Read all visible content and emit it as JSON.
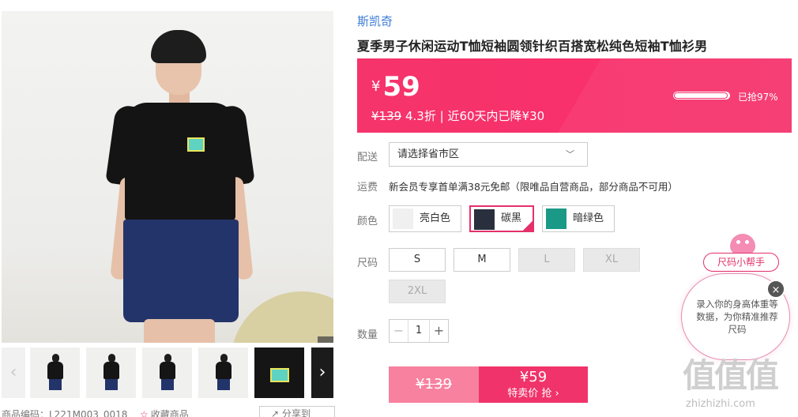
{
  "gallery": {
    "zoom_icon": "magnifier-icon",
    "prev_icon": "chevron-left-icon",
    "next_icon": "chevron-right-icon"
  },
  "meta": {
    "code": "商品编码：L221M003_0018",
    "favorite": "收藏商品",
    "share": "分享到"
  },
  "product": {
    "brand": "斯凯奇",
    "title": "夏季男子休闲运动T恤短袖圆领针织百搭宽松纯色短袖T恤衫男"
  },
  "price": {
    "currency": "¥",
    "current": "59",
    "original": "¥139",
    "discount": "4.3折",
    "drop_note": "近60天内已降¥30",
    "sold_text": "已抢97%",
    "sold_fraction": 0.97
  },
  "delivery": {
    "label": "配送",
    "placeholder": "请选择省市区"
  },
  "shipping": {
    "label": "运费",
    "text": "新会员专享首单满38元免邮（限唯品自营商品，部分商品不可用）"
  },
  "colors": {
    "label": "颜色",
    "options": [
      {
        "name": "亮白色",
        "selected": false
      },
      {
        "name": "碳黑",
        "selected": true
      },
      {
        "name": "暗绿色",
        "selected": false
      }
    ]
  },
  "sizes": {
    "label": "尺码",
    "options": [
      {
        "name": "S",
        "available": true
      },
      {
        "name": "M",
        "available": true
      },
      {
        "name": "L",
        "available": false
      },
      {
        "name": "XL",
        "available": false
      },
      {
        "name": "2XL",
        "available": false
      }
    ]
  },
  "quantity": {
    "label": "数量",
    "value": "1",
    "minus": "−",
    "plus": "+"
  },
  "buy": {
    "original": "¥139",
    "price": "¥59",
    "cta": "特卖价 抢 ›"
  },
  "size_helper": {
    "tag": "尺码小帮手",
    "bubble": "录入你的身高体重等数据，为你精准推荐尺码",
    "close": "×"
  },
  "watermark": {
    "text": "值值值",
    "url": "zhizhizhi.com"
  },
  "colors_theme": {
    "accent": "#f0336a",
    "brand_link": "#3b7bd6"
  }
}
